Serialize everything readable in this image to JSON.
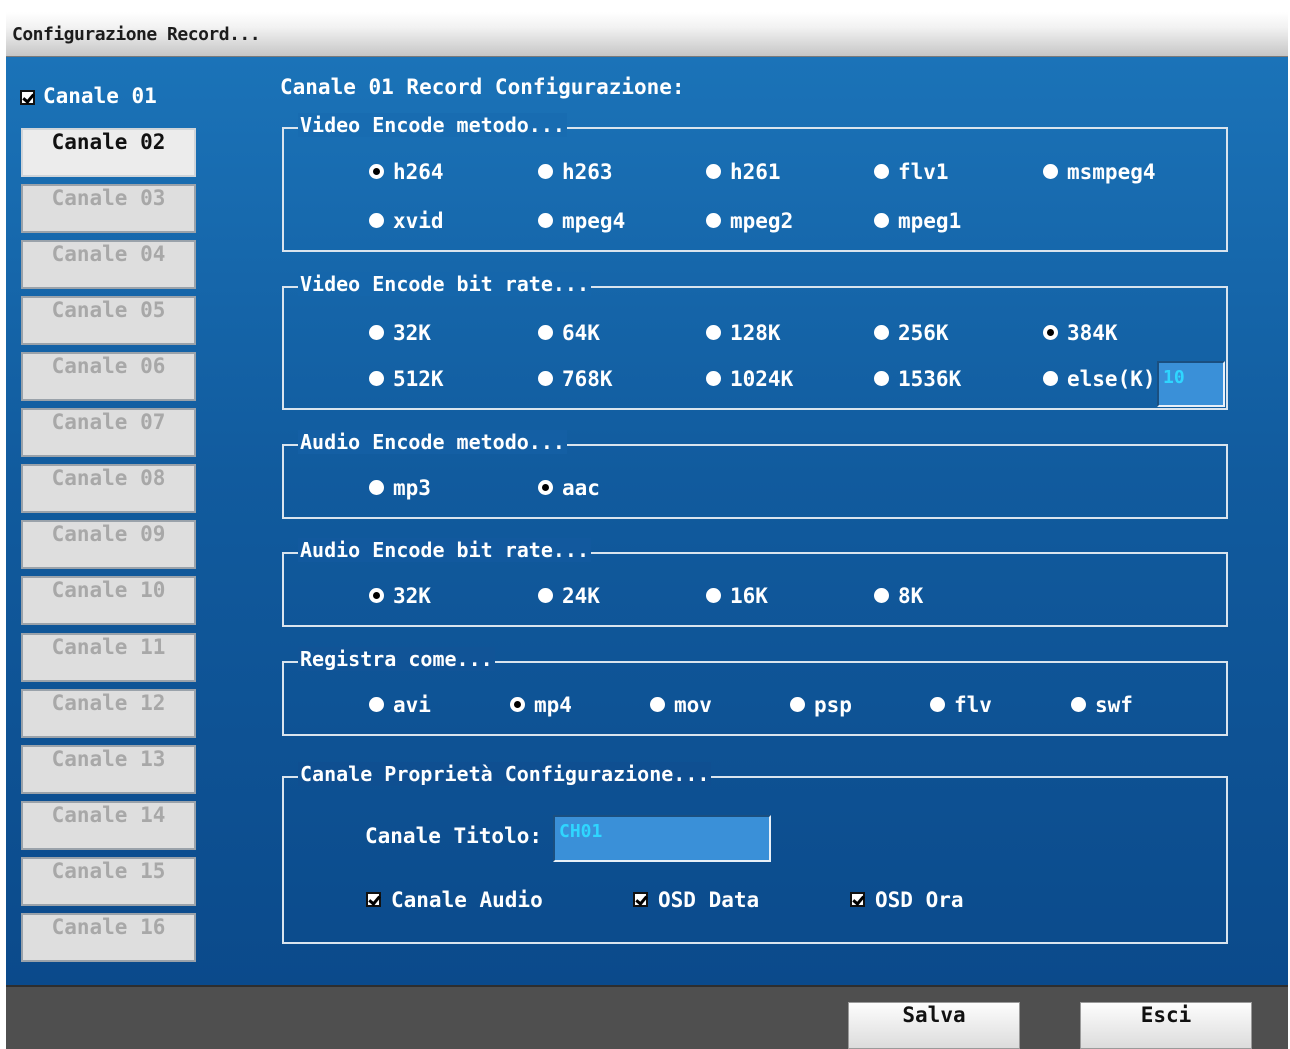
{
  "window": {
    "title": "Configurazione Record..."
  },
  "sidebar": {
    "checked_channel": "Canale 01",
    "channels": [
      "Canale 02",
      "Canale 03",
      "Canale 04",
      "Canale 05",
      "Canale 06",
      "Canale 07",
      "Canale 08",
      "Canale 09",
      "Canale 10",
      "Canale 11",
      "Canale 12",
      "Canale 13",
      "Canale 14",
      "Canale 15",
      "Canale 16"
    ]
  },
  "header": "Canale 01 Record Configurazione:",
  "video_method": {
    "title": "Video Encode metodo...",
    "options": [
      "h264",
      "h263",
      "h261",
      "flv1",
      "msmpeg4",
      "xvid",
      "mpeg4",
      "mpeg2",
      "mpeg1"
    ],
    "selected": "h264"
  },
  "video_bitrate": {
    "title": "Video Encode bit rate...",
    "options": [
      "32K",
      "64K",
      "128K",
      "256K",
      "384K",
      "512K",
      "768K",
      "1024K",
      "1536K",
      "else(K)"
    ],
    "selected": "384K",
    "else_value": "10"
  },
  "audio_method": {
    "title": "Audio Encode metodo...",
    "options": [
      "mp3",
      "aac"
    ],
    "selected": "aac"
  },
  "audio_bitrate": {
    "title": "Audio Encode bit rate...",
    "options": [
      "32K",
      "24K",
      "16K",
      "8K"
    ],
    "selected": "32K"
  },
  "record_as": {
    "title": "Registra come...",
    "options": [
      "avi",
      "mp4",
      "mov",
      "psp",
      "flv",
      "swf"
    ],
    "selected": "mp4"
  },
  "properties": {
    "title": "Canale Proprietà Configurazione...",
    "title_label": "Canale Titolo:",
    "title_value": "CH01",
    "checks": [
      "Canale Audio",
      "OSD Data",
      "OSD Ora"
    ]
  },
  "footer": {
    "save": "Salva",
    "exit": "Esci"
  },
  "colors": {
    "panel_blue": "#115b9e",
    "title_input_text": "#2fd6ff"
  }
}
